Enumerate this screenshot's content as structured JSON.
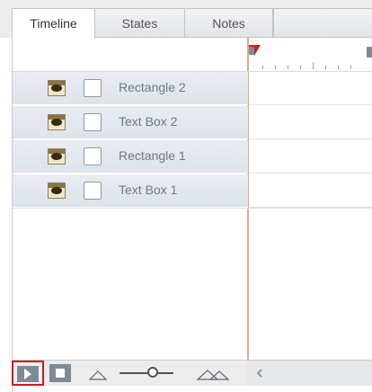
{
  "tabs": [
    {
      "label": "Timeline",
      "active": true
    },
    {
      "label": "States",
      "active": false
    },
    {
      "label": "Notes",
      "active": false
    }
  ],
  "layers": [
    {
      "name": "Rectangle 2",
      "visible": true,
      "locked": false
    },
    {
      "name": "Text Box 2",
      "visible": true,
      "locked": false
    },
    {
      "name": "Rectangle 1",
      "visible": true,
      "locked": false
    },
    {
      "name": "Text Box 1",
      "visible": true,
      "locked": false
    }
  ],
  "toolbar": {
    "play": "play",
    "stop": "stop",
    "zoom_out": "zoom-out",
    "zoom_in": "zoom-in",
    "zoom_level": 0.5
  },
  "colors": {
    "playhead": "#d01e1e",
    "divider": "#dba98a",
    "highlight": "#c61f1f"
  },
  "icons": [
    "eye-icon",
    "checkbox",
    "play-icon",
    "stop-icon",
    "mountain-small-icon",
    "mountain-large-icon",
    "chevron-left-icon"
  ]
}
